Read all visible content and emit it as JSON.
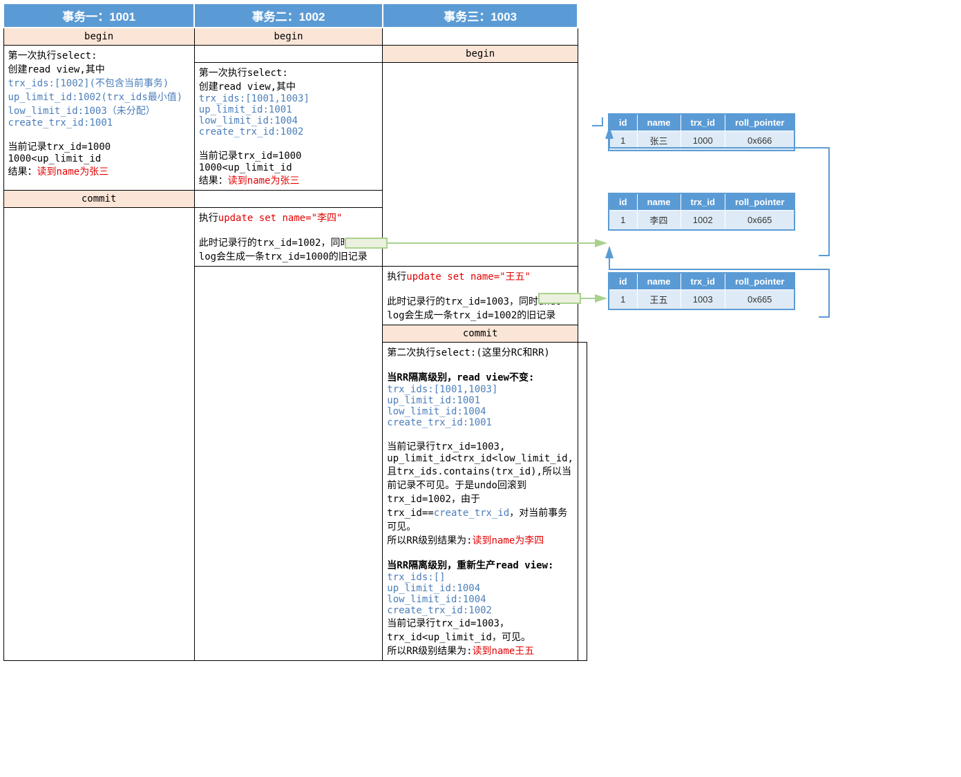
{
  "headers": {
    "col1": "事务一：1001",
    "col2": "事务二：1002",
    "col3": "事务三：1003"
  },
  "row_begin": {
    "c1": "begin",
    "c2": "begin",
    "c3": ""
  },
  "row2": {
    "c1": {
      "l1": "第一次执行select:",
      "l2": "创建read view,其中",
      "l3": "trx_ids:[1002](不包含当前事务)",
      "l4": "up_limit_id:1002(trx_ids最小值)",
      "l5": "low_limit_id:1003（未分配）",
      "l6": "create_trx_id:1001",
      "l7": "当前记录trx_id=1000",
      "l8": "1000<up_limit_id",
      "l9a": "结果：",
      "l9b": "读到name为张三"
    },
    "c2": "",
    "c3": "begin"
  },
  "row3": {
    "c2": {
      "l1": "第一次执行select:",
      "l2": "创建read view,其中",
      "l3": "trx_ids:[1001,1003]",
      "l4": "up_limit_id:1001",
      "l5": "low_limit_id:1004",
      "l6": "create_trx_id:1002",
      "l7": "当前记录trx_id=1000",
      "l8": "1000<up_limit_id",
      "l9a": "结果：",
      "l9b": "读到name为张三"
    }
  },
  "row_commit1": {
    "c1": "commit"
  },
  "row5": {
    "c2": {
      "l1a": "执行",
      "l1b": "update set name=\"李四\"",
      "l2": "此时记录行的trx_id=1002，同时undo log会生成一条trx_id=1000的旧记录"
    }
  },
  "row6": {
    "c3": {
      "l1a": "执行",
      "l1b": "update set name=\"王五\"",
      "l2": "此时记录行的trx_id=1003，同时undo log会生成一条trx_id=1002的旧记录"
    }
  },
  "row_commit3": {
    "c3": "commit"
  },
  "row8": {
    "c2": {
      "l1": "第二次执行select:(这里分RC和RR)",
      "h_rr": "当RR隔离级别，read view不变:",
      "rr1": "trx_ids:[1001,1003]",
      "rr2": "up_limit_id:1001",
      "rr3": "low_limit_id:1004",
      "rr4": "create_trx_id:1001",
      "p1": "当前记录行trx_id=1003,",
      "p2": "up_limit_id<trx_id<low_limit_id,",
      "p3": "且trx_ids.contains(trx_id),所以当前记录不可见。于是undo回滚到trx_id=1002，由于",
      "p4a": "trx_id==",
      "p4b": "create_trx_id",
      "p4c": "，对当前事务可见。",
      "p5a": "所以RR级别结果为:",
      "p5b": "读到name为李四",
      "h_rc": "当RR隔离级别，重新生产read view:",
      "rc1": "trx_ids:[]",
      "rc2": "up_limit_id:1004",
      "rc3": "low_limit_id:1004",
      "rc4": "create_trx_id:1002",
      "q1": "当前记录行trx_id=1003，",
      "q2": "trx_id<up_limit_id，可见。",
      "q3a": "所以RR级别结果为:",
      "q3b": "读到name王五"
    }
  },
  "mini": {
    "headers": {
      "id": "id",
      "name": "name",
      "trx": "trx_id",
      "ptr": "roll_pointer"
    },
    "t1": {
      "id": "1",
      "name": "张三",
      "trx": "1000",
      "ptr": "0x666"
    },
    "t2": {
      "id": "1",
      "name": "李四",
      "trx": "1002",
      "ptr": "0x665"
    },
    "t3": {
      "id": "1",
      "name": "王五",
      "trx": "1003",
      "ptr": "0x665"
    }
  }
}
